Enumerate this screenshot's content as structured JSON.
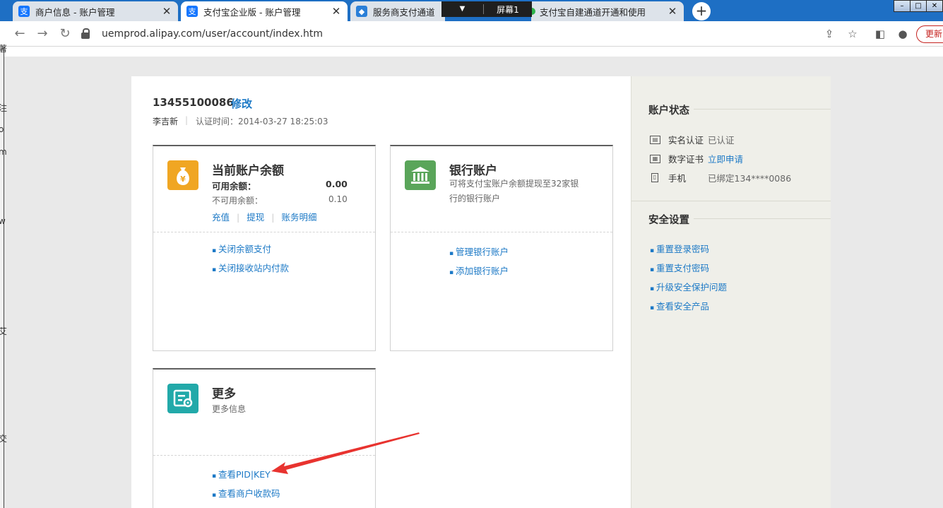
{
  "browser": {
    "tabs": [
      {
        "title": "商户信息 - 账户管理",
        "favicon": "支"
      },
      {
        "title": "支付宝企业版 - 账户管理",
        "favicon": "支"
      },
      {
        "title": "服务商支付通道",
        "favicon": "◆"
      },
      {
        "title": "支付宝自建通道开通和使用",
        "favicon": ""
      }
    ],
    "overlay_label": "屏幕1",
    "url": "uemprod.alipay.com/user/account/index.htm",
    "update_label": "更新",
    "accent": "#1e6fc4"
  },
  "left_strip": [
    "著",
    "注",
    "o",
    "m",
    "w",
    "艾",
    "交"
  ],
  "account": {
    "id": "13455100086",
    "edit_label": "修改",
    "name": "李吉新",
    "separator": "|",
    "verified_time": "认证时间：2014-03-27 18:25:03"
  },
  "balance_card": {
    "title": "当前账户余额",
    "available_label": "可用余额：",
    "available_value": "0.00",
    "frozen_label": "不可用余额：",
    "frozen_value": "0.10",
    "actions": [
      "充值",
      "提现",
      "账务明细"
    ],
    "links": [
      "关闭余额支付",
      "关闭接收站内付款"
    ],
    "icon_color": "#f0a623"
  },
  "bank_card": {
    "title": "银行账户",
    "description_line1": "可将支付宝账户余额提现至32家银",
    "description_line2": "行的银行账户",
    "links": [
      "管理银行账户",
      "添加银行账户"
    ],
    "icon_color": "#5aa55a"
  },
  "more_card": {
    "title": "更多",
    "description": "更多信息",
    "links": [
      "查看PID|KEY",
      "查看商户收款码"
    ],
    "icon_color": "#22a9a9"
  },
  "sidebar": {
    "status_title": "账户状态",
    "status_rows": [
      {
        "label": "实名认证",
        "value": "已认证",
        "value_is_link": false
      },
      {
        "label": "数字证书",
        "value": "立即申请",
        "value_is_link": true
      },
      {
        "label": "手机",
        "value": "已绑定134****0086",
        "value_is_link": false
      }
    ],
    "security_title": "安全设置",
    "security_links": [
      "重置登录密码",
      "重置支付密码",
      "升级安全保护问题",
      "查看安全产品"
    ]
  },
  "annotation_color": "#e8332f"
}
